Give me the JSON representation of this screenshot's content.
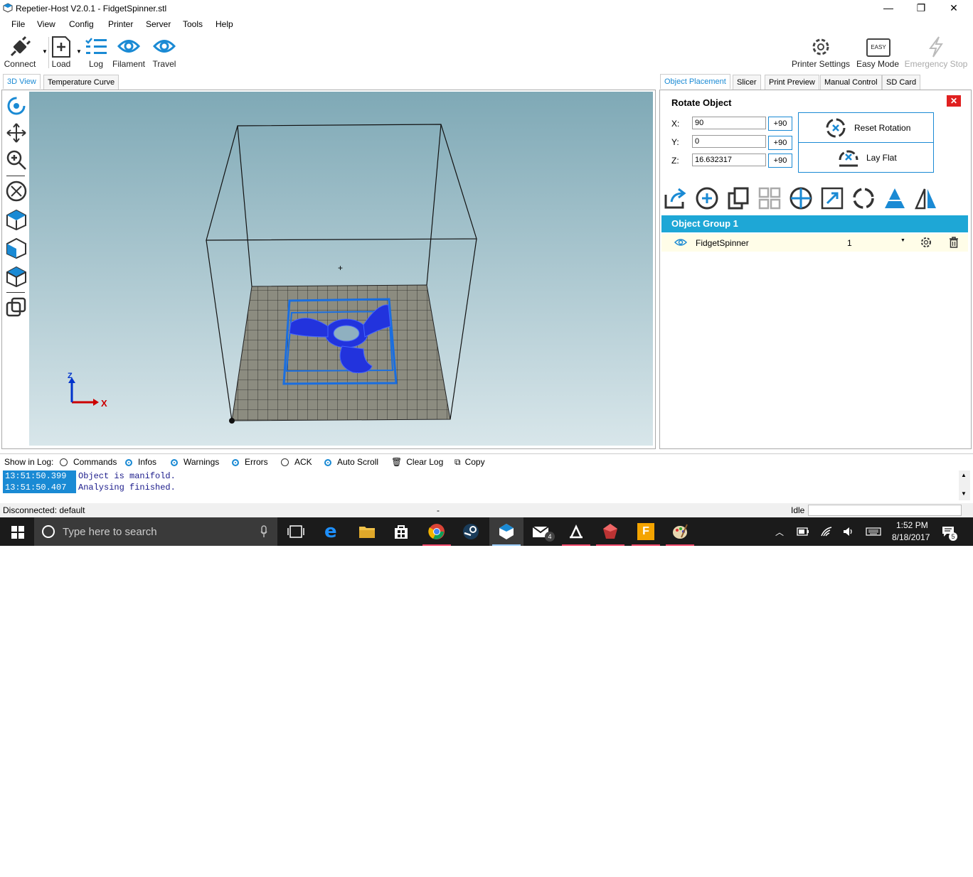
{
  "window": {
    "title": "Repetier-Host V2.0.1 - FidgetSpinner.stl",
    "minimize_glyph": "—",
    "restore_glyph": "❐",
    "close_glyph": "✕"
  },
  "menu": [
    "File",
    "View",
    "Config",
    "Printer",
    "Server",
    "Tools",
    "Help"
  ],
  "toolbar": {
    "connect": "Connect",
    "load": "Load",
    "log": "Log",
    "filament": "Filament",
    "travel": "Travel",
    "printer_settings": "Printer Settings",
    "easy_mode": "Easy Mode",
    "easy_badge": "EASY",
    "emergency_stop": "Emergency Stop"
  },
  "left_tabs": [
    "3D View",
    "Temperature Curve"
  ],
  "right_tabs": [
    "Object Placement",
    "Slicer",
    "Print Preview",
    "Manual Control",
    "SD Card"
  ],
  "rotate": {
    "heading": "Rotate Object",
    "x_label": "X:",
    "x_value": "90",
    "y_label": "Y:",
    "y_value": "0",
    "z_label": "Z:",
    "z_value": "16.632317",
    "plus90": "+90",
    "reset_rotation": "Reset Rotation",
    "lay_flat": "Lay Flat"
  },
  "object_group": {
    "name": "Object Group 1",
    "object_name": "FidgetSpinner",
    "copies": "1"
  },
  "axes": {
    "x": "X",
    "z": "Z"
  },
  "log": {
    "show_label": "Show in Log:",
    "options": [
      {
        "label": "Commands",
        "on": false
      },
      {
        "label": "Infos",
        "on": true
      },
      {
        "label": "Warnings",
        "on": true
      },
      {
        "label": "Errors",
        "on": true
      },
      {
        "label": "ACK",
        "on": false
      },
      {
        "label": "Auto Scroll",
        "on": true
      }
    ],
    "clear": "Clear Log",
    "copy": "Copy",
    "entries": [
      {
        "time": "13:51:50.399",
        "message": "Object is manifold."
      },
      {
        "time": "13:51:50.407",
        "message": "Analysing finished."
      }
    ]
  },
  "status": {
    "connection": "Disconnected: default",
    "middle": "-",
    "state": "Idle"
  },
  "taskbar": {
    "search_placeholder": "Type here to search",
    "mail_badge": "4",
    "time": "1:52 PM",
    "date": "8/18/2017",
    "notif_count": "5"
  },
  "colors": {
    "accent": "#1a8ad4",
    "model_blue": "#2233dd",
    "bed": "#8c8c80",
    "close_red": "#e02020"
  }
}
